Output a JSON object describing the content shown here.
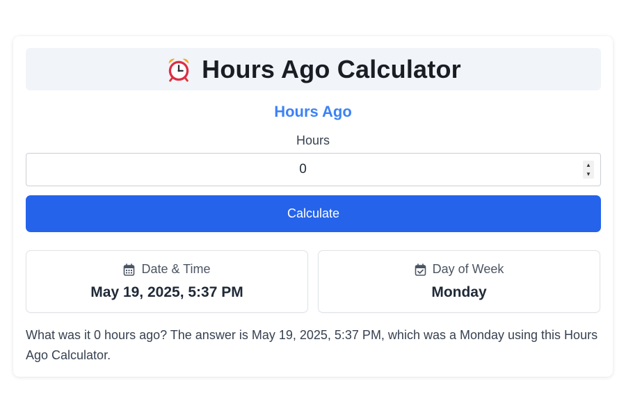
{
  "header": {
    "title": "Hours Ago Calculator",
    "icon": "alarm-clock-icon"
  },
  "form": {
    "subtitle": "Hours Ago",
    "hours_label": "Hours",
    "hours_value": "0",
    "calculate_label": "Calculate"
  },
  "results": {
    "date_time_label": "Date & Time",
    "date_time_icon": "calendar-icon",
    "date_time_value": "May 19, 2025, 5:37 PM",
    "day_label": "Day of Week",
    "day_icon": "calendar-check-icon",
    "day_value": "Monday"
  },
  "description": "What was it 0 hours ago? The answer is May 19, 2025, 5:37 PM, which was a Monday using this Hours Ago Calculator.",
  "colors": {
    "accent": "#3b82f6",
    "button": "#2563eb",
    "title_bg": "#f1f4f8"
  }
}
